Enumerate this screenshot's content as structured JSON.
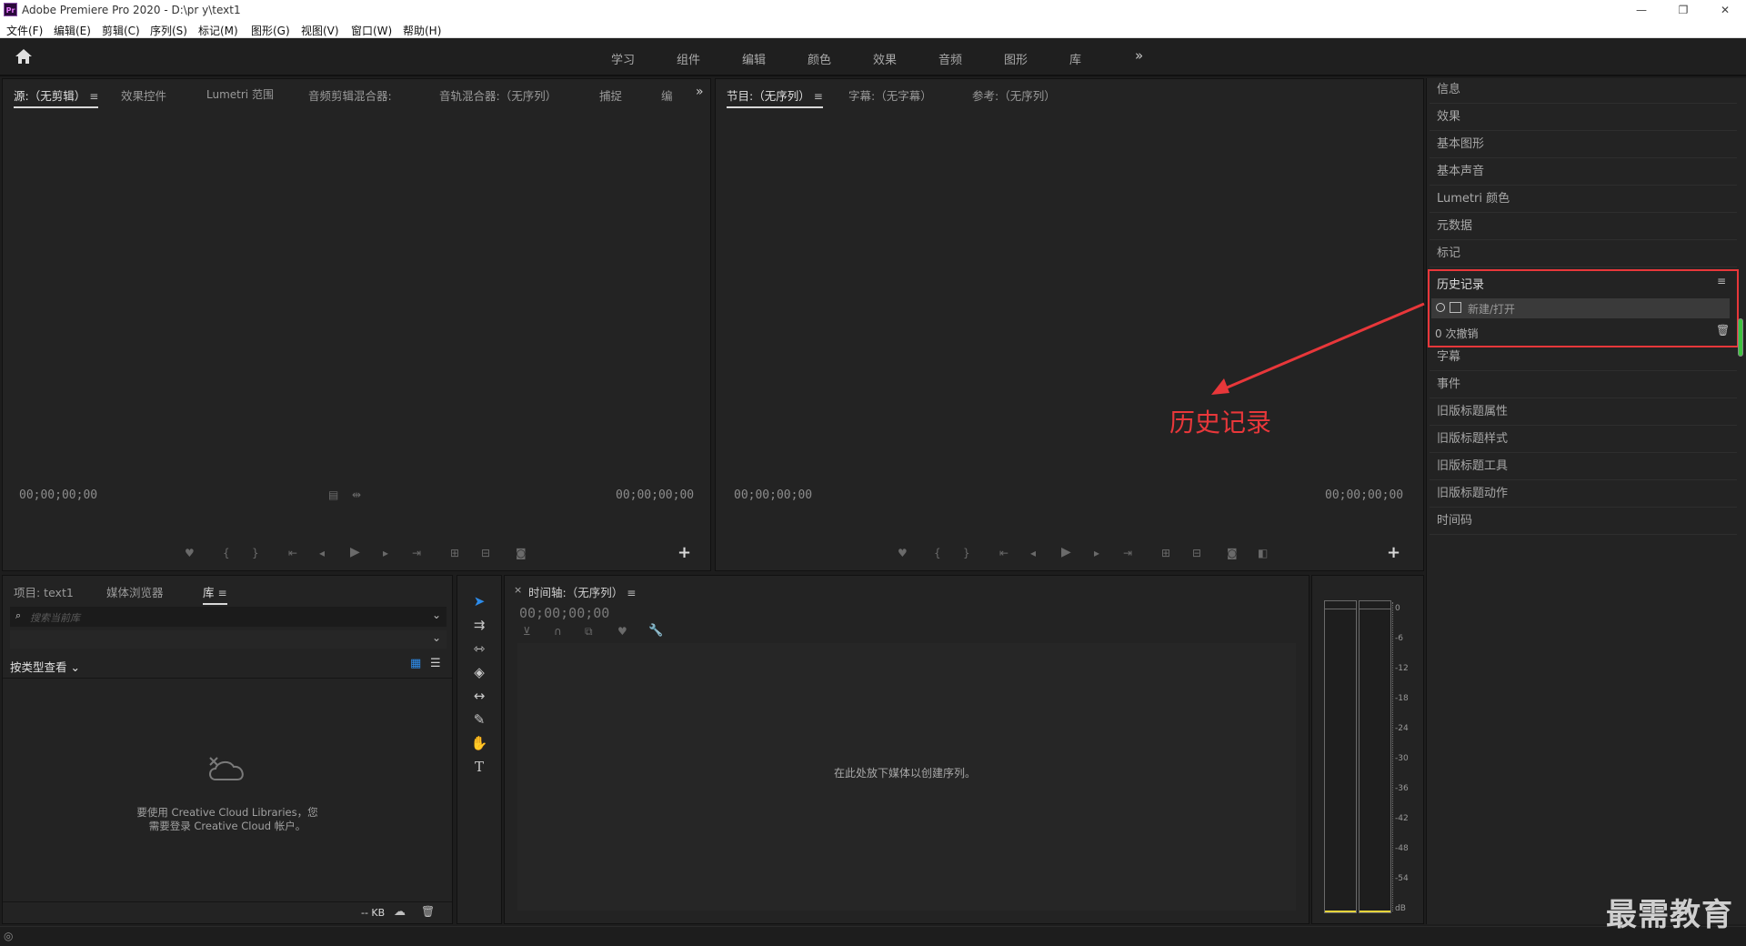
{
  "window": {
    "title": "Adobe Premiere Pro 2020 - D:\\pr y\\text1",
    "app_icon": "Pr",
    "controls": [
      "—",
      "❐",
      "✕"
    ]
  },
  "menu": [
    "文件(F)",
    "编辑(E)",
    "剪辑(C)",
    "序列(S)",
    "标记(M)",
    "图形(G)",
    "视图(V)",
    "窗口(W)",
    "帮助(H)"
  ],
  "workspaces": [
    "学习",
    "组件",
    "编辑",
    "颜色",
    "效果",
    "音频",
    "图形",
    "库"
  ],
  "source_panel": {
    "tabs": [
      "源:（无剪辑）",
      "效果控件",
      "Lumetri 范围",
      "音频剪辑混合器:",
      "音轨混合器:（无序列）",
      "捕捉",
      "编"
    ],
    "timecode_left": "00;00;00;00",
    "timecode_right": "00;00;00;00"
  },
  "program_panel": {
    "tabs": [
      "节目:（无序列）",
      "字幕:（无字幕）",
      "参考:（无序列）"
    ],
    "timecode_left": "00;00;00;00",
    "timecode_right": "00;00;00;00"
  },
  "project_panel": {
    "tabs": [
      "项目: text1",
      "媒体浏览器",
      "库"
    ],
    "search_placeholder": "搜索当前库",
    "view_by": "按类型查看",
    "message_line1": "要使用 Creative Cloud Libraries，您",
    "message_line2": "需要登录 Creative Cloud 帐户。",
    "kb_label": "-- KB"
  },
  "timeline_panel": {
    "tab": "时间轴:（无序列）",
    "timecode": "00;00;00;00",
    "drop_hint": "在此处放下媒体以创建序列。"
  },
  "audio_meter": {
    "scale": [
      "0",
      "-6",
      "-12",
      "-18",
      "-24",
      "-30",
      "-36",
      "-42",
      "-48",
      "-54",
      "dB"
    ]
  },
  "right_panel": {
    "items_top": [
      "信息",
      "效果",
      "基本图形",
      "基本声音",
      "Lumetri 颜色",
      "元数据",
      "标记"
    ],
    "history": {
      "title": "历史记录",
      "entry": "新建/打开",
      "undo_count": "0 次撤销"
    },
    "items_bottom": [
      "字幕",
      "事件",
      "旧版标题属性",
      "旧版标题样式",
      "旧版标题工具",
      "旧版标题动作",
      "时间码"
    ]
  },
  "annotation": {
    "label": "历史记录",
    "color": "#e8373a"
  },
  "watermark": "最需教育",
  "colors": {
    "accent_blue": "#2d8ceb",
    "highlight_red": "#e8373a",
    "meter_green": "#3ec43e"
  }
}
